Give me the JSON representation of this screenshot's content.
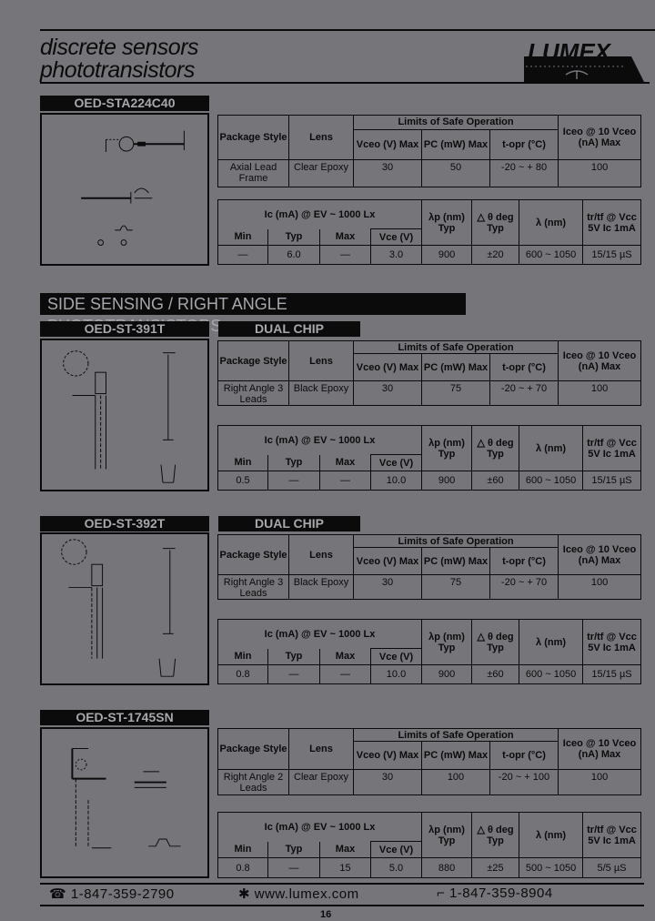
{
  "header": {
    "title_line1": "discrete sensors",
    "title_line2": "phototransistors",
    "logo_text": "LUMEX"
  },
  "section_title": "SIDE SENSING / RIGHT ANGLE PHOTOTRANSISTORS",
  "limits_headers": {
    "package_style": "Package Style",
    "lens": "Lens",
    "group": "Limits of Safe Operation",
    "vceo": "Vceo (V) Max",
    "pc": "PC (mW) Max",
    "topr": "t-opr (°C)",
    "iceo": "Iceo @ 10 Vceo (nA) Max"
  },
  "optical_headers": {
    "group": "Ic (mA) @ EV ~ 1000 Lx",
    "min": "Min",
    "typ": "Typ",
    "max": "Max",
    "vce": "Vce (V)",
    "lambda_p": "λp (nm) Typ",
    "theta": "△ θ deg Typ",
    "lambda": "λ (nm)",
    "trtf": "tr/tf @ Vcc 5V Ic 1mA"
  },
  "products": [
    {
      "model": "OED-STA224C40",
      "badge": "",
      "limits": {
        "package_style": "Axial Lead Frame",
        "lens": "Clear Epoxy",
        "vceo": "30",
        "pc": "50",
        "topr": "-20 ~ + 80",
        "iceo": "100"
      },
      "optical": {
        "min": "—",
        "typ": "6.0",
        "max": "—",
        "vce": "3.0",
        "lambda_p": "900",
        "theta": "±20",
        "lambda": "600 ~ 1050",
        "trtf": "15/15 µS"
      }
    },
    {
      "model": "OED-ST-391T",
      "badge": "DUAL CHIP",
      "limits": {
        "package_style": "Right Angle 3 Leads",
        "lens": "Black Epoxy",
        "vceo": "30",
        "pc": "75",
        "topr": "-20 ~ + 70",
        "iceo": "100"
      },
      "optical": {
        "min": "0.5",
        "typ": "—",
        "max": "—",
        "vce": "10.0",
        "lambda_p": "900",
        "theta": "±60",
        "lambda": "600 ~ 1050",
        "trtf": "15/15 µS"
      }
    },
    {
      "model": "OED-ST-392T",
      "badge": "DUAL CHIP",
      "limits": {
        "package_style": "Right Angle 3 Leads",
        "lens": "Black Epoxy",
        "vceo": "30",
        "pc": "75",
        "topr": "-20 ~ + 70",
        "iceo": "100"
      },
      "optical": {
        "min": "0.8",
        "typ": "—",
        "max": "—",
        "vce": "10.0",
        "lambda_p": "900",
        "theta": "±60",
        "lambda": "600 ~ 1050",
        "trtf": "15/15 µS"
      }
    },
    {
      "model": "OED-ST-1745SN",
      "badge": "",
      "limits": {
        "package_style": "Right Angle 2 Leads",
        "lens": "Clear Epoxy",
        "vceo": "30",
        "pc": "100",
        "topr": "-20 ~ + 100",
        "iceo": "100"
      },
      "optical": {
        "min": "0.8",
        "typ": "—",
        "max": "15",
        "vce": "5.0",
        "lambda_p": "880",
        "theta": "±25",
        "lambda": "500 ~ 1050",
        "trtf": "5/5 µS"
      }
    }
  ],
  "footer": {
    "phone_icon": "phone-icon",
    "phone": "1-847-359-2790",
    "web_icon": "globe-icon",
    "website": "www.lumex.com",
    "fax_icon": "fax-icon",
    "fax": "1-847-359-8904",
    "page_number": "16"
  }
}
